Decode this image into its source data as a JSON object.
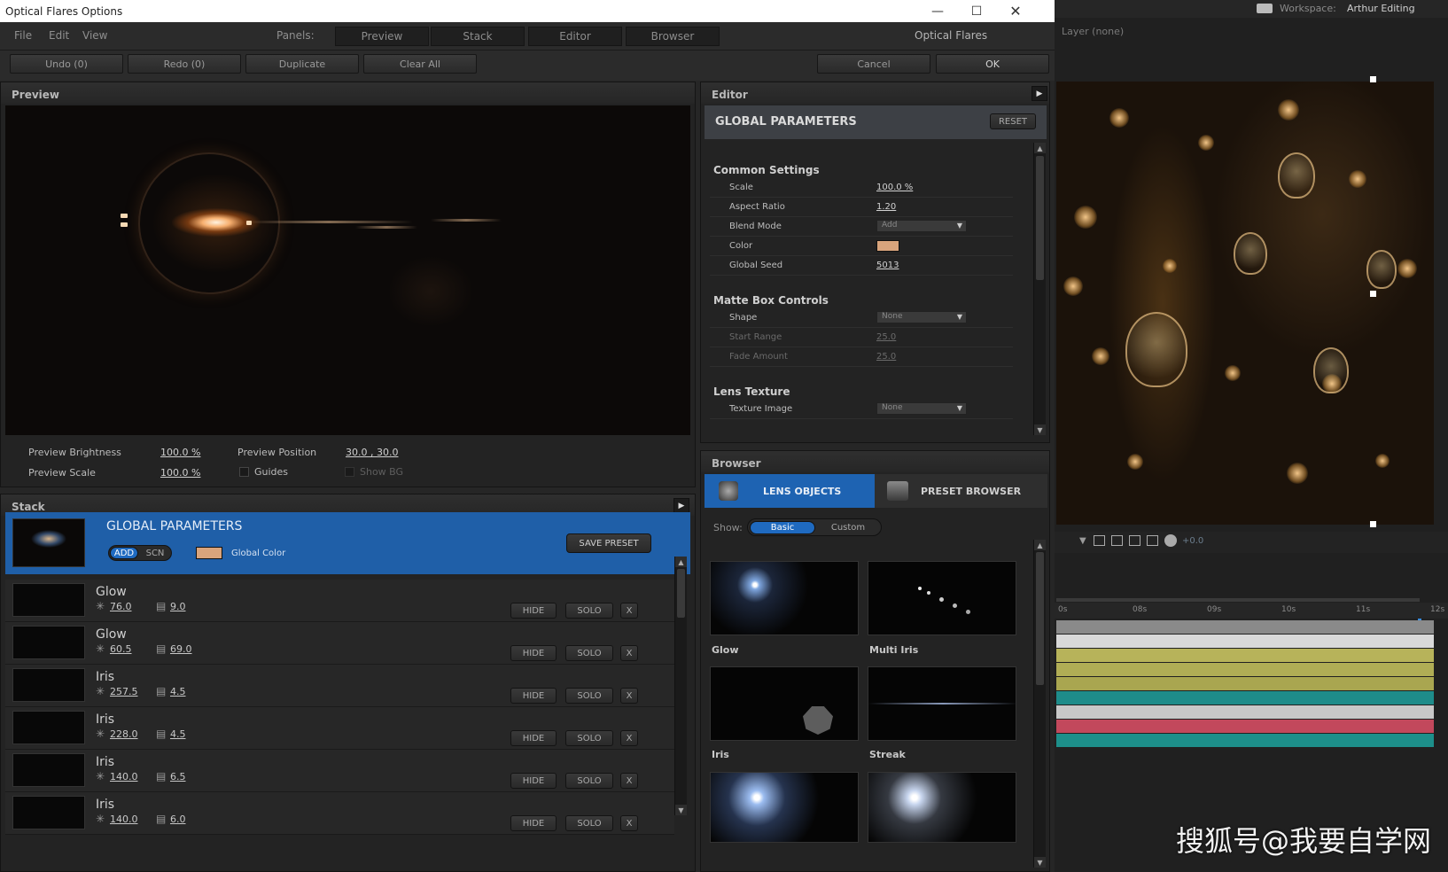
{
  "window": {
    "title": "Optical Flares Options",
    "minimize": "—",
    "maximize": "☐",
    "close": "✕"
  },
  "menu": {
    "file": "File",
    "edit": "Edit",
    "view": "View",
    "panels_label": "Panels:",
    "app_name": "Optical Flares"
  },
  "panel_tabs": [
    "Preview",
    "Stack",
    "Editor",
    "Browser"
  ],
  "toolbar": {
    "undo": "Undo (0)",
    "redo": "Redo (0)",
    "duplicate": "Duplicate",
    "clear_all": "Clear All",
    "cancel": "Cancel",
    "ok": "OK"
  },
  "preview": {
    "title": "Preview",
    "brightness_label": "Preview Brightness",
    "brightness_value": "100.0 %",
    "scale_label": "Preview Scale",
    "scale_value": "100.0 %",
    "position_label": "Preview Position",
    "position_value": "30.0 , 30.0",
    "guides_label": "Guides",
    "show_bg_label": "Show BG"
  },
  "stack": {
    "title": "Stack",
    "global": {
      "title": "GLOBAL PARAMETERS",
      "add": "ADD",
      "scn": "SCN",
      "color_label": "Global Color",
      "save_preset": "SAVE PRESET",
      "color": "#d9a47c"
    },
    "rows": [
      {
        "name": "Glow",
        "brightness": "76.0",
        "scale": "9.0"
      },
      {
        "name": "Glow",
        "brightness": "60.5",
        "scale": "69.0"
      },
      {
        "name": "Iris",
        "brightness": "257.5",
        "scale": "4.5"
      },
      {
        "name": "Iris",
        "brightness": "228.0",
        "scale": "4.5"
      },
      {
        "name": "Iris",
        "brightness": "140.0",
        "scale": "6.5"
      },
      {
        "name": "Iris",
        "brightness": "140.0",
        "scale": "6.0"
      }
    ],
    "hide": "HIDE",
    "solo": "SOLO",
    "remove": "X"
  },
  "editor": {
    "title": "Editor",
    "section_title": "GLOBAL PARAMETERS",
    "reset": "RESET",
    "common": {
      "title": "Common Settings",
      "scale_label": "Scale",
      "scale_value": "100.0 %",
      "aspect_label": "Aspect Ratio",
      "aspect_value": "1.20",
      "blend_label": "Blend Mode",
      "blend_value": "Add",
      "color_label": "Color",
      "color": "#d9a47c",
      "seed_label": "Global Seed",
      "seed_value": "5013"
    },
    "matte": {
      "title": "Matte Box Controls",
      "shape_label": "Shape",
      "shape_value": "None",
      "start_label": "Start Range",
      "start_value": "25.0",
      "fade_label": "Fade Amount",
      "fade_value": "25.0"
    },
    "lens": {
      "title": "Lens Texture",
      "texture_label": "Texture Image",
      "texture_value": "None"
    }
  },
  "browser": {
    "title": "Browser",
    "tab_lens": "LENS OBJECTS",
    "tab_preset": "PRESET BROWSER",
    "show_label": "Show:",
    "basic": "Basic",
    "custom": "Custom",
    "items": [
      "Glow",
      "Multi Iris",
      "Iris",
      "Streak"
    ]
  },
  "ae": {
    "workspace_label": "Workspace:",
    "workspace_value": "Arthur Editing",
    "layer_label": "Layer (none)",
    "time_offset": "+0.0",
    "ticks": [
      "0s",
      "08s",
      "09s",
      "10s",
      "11s",
      "12s"
    ]
  },
  "watermark": "搜狐号@我要自学网",
  "track_colors": [
    "#8a8a8a",
    "#d9d9d9",
    "#b7b35a",
    "#b0ad55",
    "#a9a650",
    "#1e8c8a",
    "#c8c8c8",
    "#c2485c",
    "#1d8f8a"
  ]
}
